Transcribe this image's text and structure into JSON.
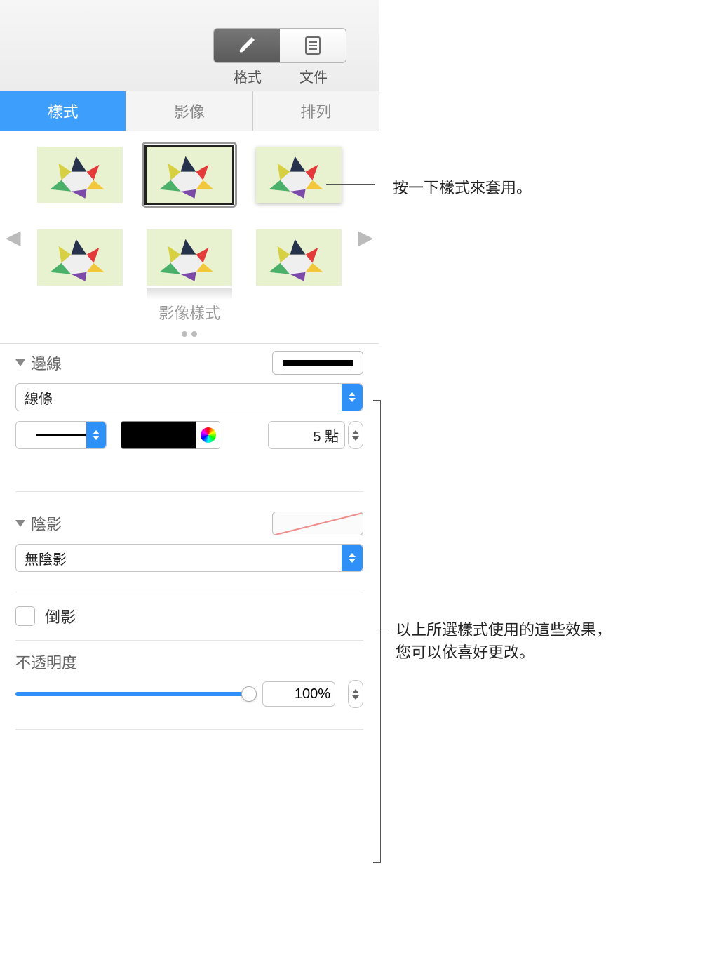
{
  "toolbar": {
    "format_label": "格式",
    "document_label": "文件"
  },
  "tabs": {
    "style": "樣式",
    "image": "影像",
    "arrange": "排列"
  },
  "style_caption": "影像樣式",
  "border": {
    "title": "邊線",
    "type_value": "線條",
    "width_value": "5 點"
  },
  "shadow": {
    "title": "陰影",
    "type_value": "無陰影"
  },
  "reflection": {
    "label": "倒影"
  },
  "opacity": {
    "label": "不透明度",
    "value": "100%"
  },
  "annotations": {
    "click_style": "按一下樣式來套用。",
    "effects_line1": "以上所選樣式使用的這些效果，",
    "effects_line2": "您可以依喜好更改。"
  }
}
